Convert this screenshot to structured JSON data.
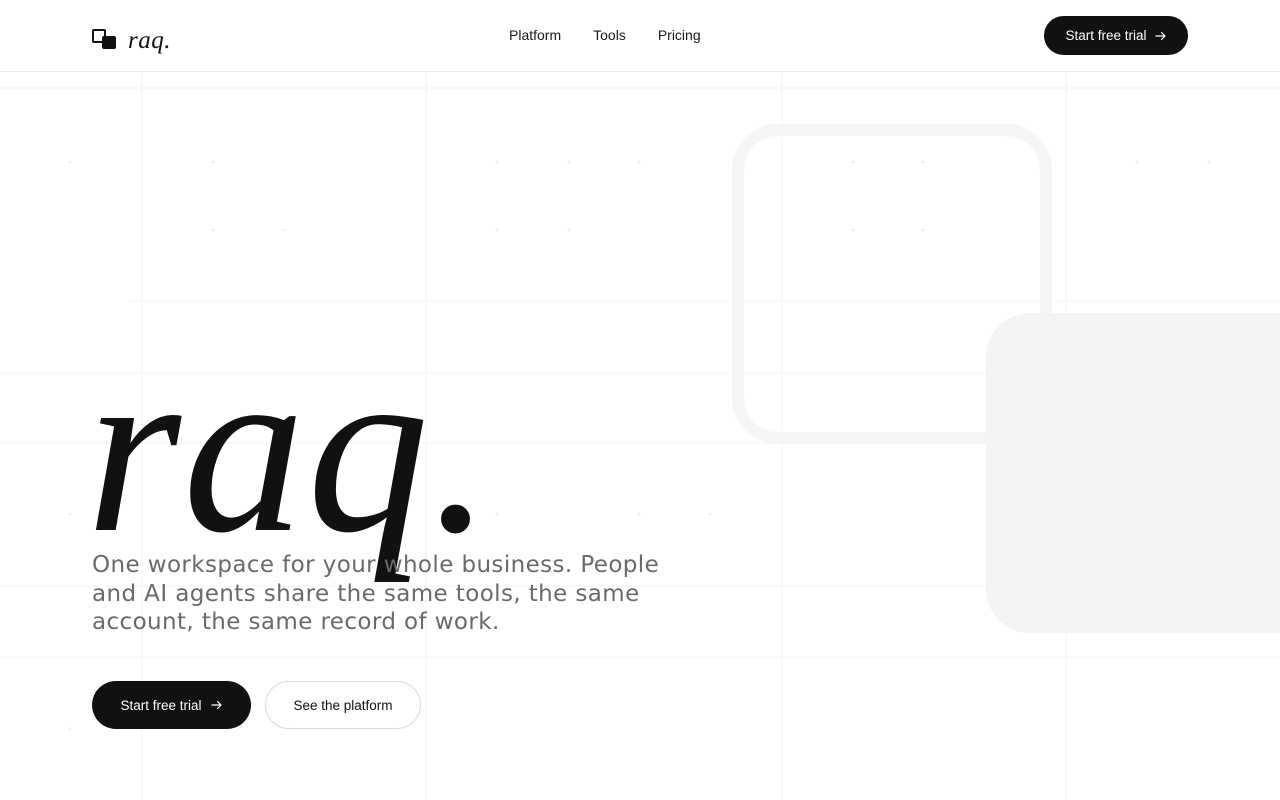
{
  "brand": {
    "logo_icon": "overlapping-squares-icon",
    "name": "raq."
  },
  "nav": {
    "items": [
      {
        "label": "Platform"
      },
      {
        "label": "Tools"
      },
      {
        "label": "Pricing"
      }
    ]
  },
  "header_cta": {
    "label": "Start free trial",
    "icon": "arrow-right-icon"
  },
  "hero": {
    "wordmark": "raq.",
    "tagline": "One workspace for your whole business. People and AI agents share the same tools, the same account, the same record of work.",
    "primary_cta": {
      "label": "Start free trial",
      "icon": "arrow-right-icon"
    },
    "secondary_cta": {
      "label": "See the platform"
    }
  },
  "colors": {
    "background": "#ffffff",
    "text": "#111111",
    "muted_text": "#6a6a6a",
    "button_dark": "#111111",
    "decor_gray": "#f4f4f4"
  }
}
